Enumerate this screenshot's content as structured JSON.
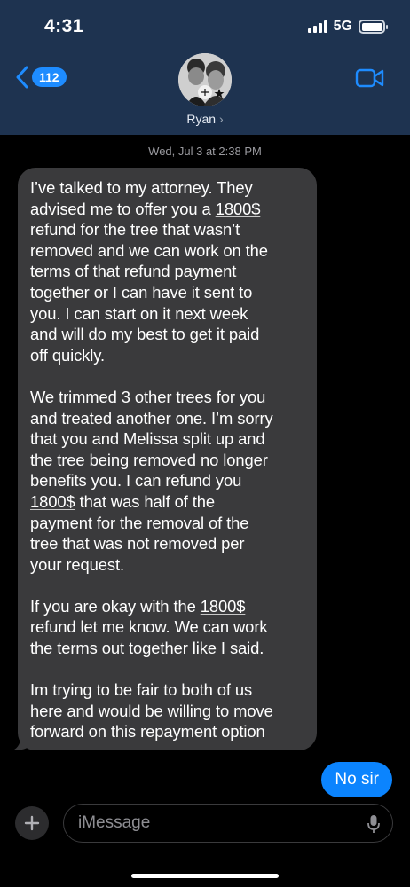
{
  "status_bar": {
    "time": "4:31",
    "network": "5G"
  },
  "nav": {
    "back_count": "112",
    "contact_name": "Ryan",
    "contact_chevron": "›"
  },
  "conversation": {
    "timestamp": "Wed, Jul 3 at 2:38 PM",
    "incoming_message": {
      "paragraph_1_lines": [
        "I’ve talked to my attorney. They",
        [
          "advised me to offer you a ",
          "1800$"
        ],
        "refund for the tree that wasn’t",
        "removed and we can work on the",
        "terms of that refund payment",
        "together or I can have it sent to",
        "you. I can start on it next week",
        "and will do my best to get it paid",
        "off quickly."
      ],
      "paragraph_2_lines": [
        "We trimmed 3 other trees for you",
        "and treated another one. I’m sorry",
        "that you and Melissa split up and",
        "the tree being removed no longer",
        "benefits you. I can refund you",
        [
          "",
          "1800$",
          " that was half of the"
        ],
        "payment for the removal of the",
        "tree that was not removed per",
        "your request."
      ],
      "paragraph_3_lines": [
        [
          "If you are okay with the ",
          "1800$"
        ],
        "refund let me know. We can work",
        "the terms out together like I said."
      ],
      "paragraph_4_lines": [
        "Im trying to be fair to both of us",
        "here and would be willing to move",
        "forward on this repayment option"
      ]
    },
    "outgoing_message": "No sir"
  },
  "composer": {
    "placeholder": "iMessage"
  },
  "colors": {
    "header_bg": "#1e3350",
    "accent_blue": "#0b84fe",
    "incoming_bubble": "#3a3a3c"
  },
  "icons": [
    "back-chevron-icon",
    "video-call-icon",
    "plus-icon",
    "microphone-icon",
    "signal-icon",
    "battery-icon"
  ]
}
